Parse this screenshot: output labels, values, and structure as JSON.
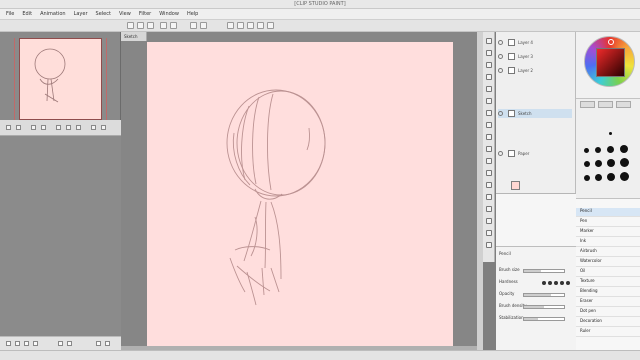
{
  "window": {
    "title": "[CLIP STUDIO PAINT]"
  },
  "menu": {
    "items": [
      "File",
      "Edit",
      "Animation",
      "Layer",
      "Select",
      "View",
      "Filter",
      "Window",
      "Help"
    ]
  },
  "canvas": {
    "tab_label": "Sketch",
    "background": "#ffdedd"
  },
  "layers": {
    "rows": [
      {
        "label": "Layer 4"
      },
      {
        "label": "Layer 3"
      },
      {
        "label": "Layer 2"
      },
      {
        "label": "Sketch"
      },
      {
        "label": "Paper"
      }
    ]
  },
  "colors": {
    "nav_border": "#8f4c4c",
    "selected_layer": "#cfe0ef"
  },
  "sub_tools": {
    "items": [
      "Pencil",
      "Pen",
      "Marker",
      "Ink",
      "Airbrush",
      "Watercolor",
      "Oil",
      "Texture",
      "Blending",
      "Eraser",
      "Dot pen",
      "Decoration",
      "Ruler"
    ]
  },
  "tool_properties": {
    "title": "Pencil",
    "rows": [
      "Brush size",
      "Hardness",
      "Opacity",
      "Brush density",
      "Stabilization"
    ],
    "brush_size_fill": 0.42,
    "opacity_fill": 0.68,
    "density_fill": 0.5,
    "stabilization_fill": 0.36
  }
}
